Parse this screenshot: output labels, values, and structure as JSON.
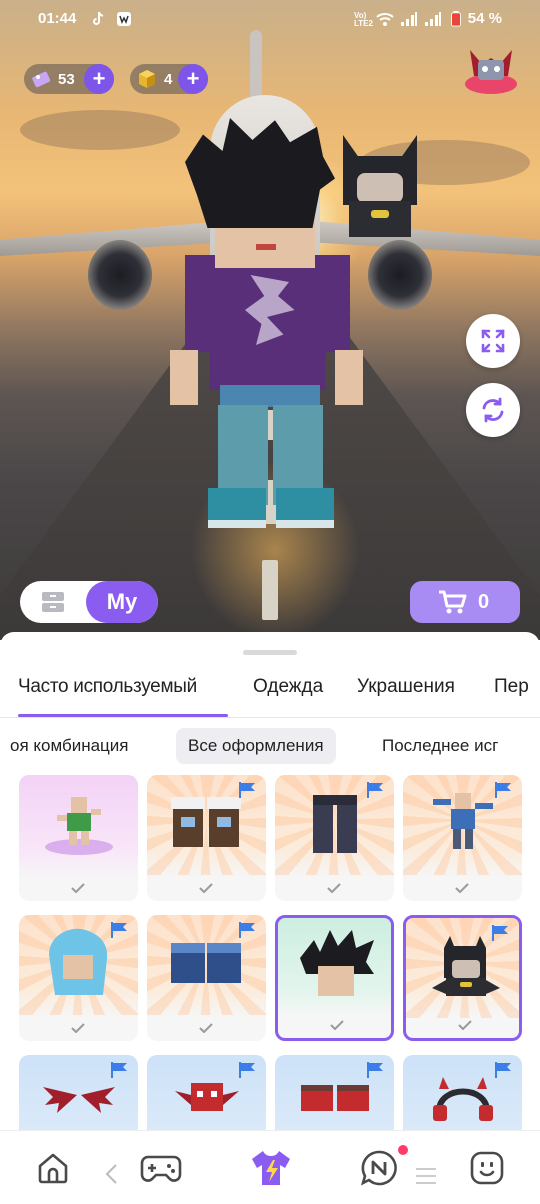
{
  "status_bar": {
    "time": "01:44",
    "network": "Vo) LTE2",
    "battery": "54 %"
  },
  "currency": {
    "gems": "53",
    "cubes": "4"
  },
  "colors": {
    "accent": "#8a5cf0",
    "accent_light": "#a88bf3",
    "plus_button": "#7d55e8",
    "notification_dot": "#ff3b6b"
  },
  "controls": {
    "mode_label": "My",
    "cart_count": "0"
  },
  "tabs": [
    {
      "label": "Часто используемый",
      "active": true
    },
    {
      "label": "Одежда",
      "active": false
    },
    {
      "label": "Украшения",
      "active": false
    },
    {
      "label": "Пер",
      "active": false
    }
  ],
  "filters": [
    {
      "label": "оя комбинация",
      "active": false
    },
    {
      "label": "Все оформления",
      "active": true
    },
    {
      "label": "Последнее исг",
      "active": false
    }
  ],
  "items": [
    {
      "icon": "dance-pose-icon",
      "flag": false,
      "selected": false,
      "bg": "pink"
    },
    {
      "icon": "boots-icon",
      "flag": true,
      "selected": false,
      "bg": "peach"
    },
    {
      "icon": "dark-pants-icon",
      "flag": true,
      "selected": false,
      "bg": "peach"
    },
    {
      "icon": "dab-pose-icon",
      "flag": true,
      "selected": false,
      "bg": "peach"
    },
    {
      "icon": "blue-hair-icon",
      "flag": true,
      "selected": false,
      "bg": "peach"
    },
    {
      "icon": "blue-shoes-icon",
      "flag": true,
      "selected": false,
      "bg": "peach"
    },
    {
      "icon": "spiky-black-hair-icon",
      "flag": false,
      "selected": true,
      "bg": "green"
    },
    {
      "icon": "batman-pet-icon",
      "flag": true,
      "selected": true,
      "bg": "peach"
    },
    {
      "icon": "red-wings-icon",
      "flag": true,
      "selected": false,
      "bg": "blue"
    },
    {
      "icon": "red-demon-pet-icon",
      "flag": true,
      "selected": false,
      "bg": "blue"
    },
    {
      "icon": "red-sneakers-icon",
      "flag": true,
      "selected": false,
      "bg": "blue"
    },
    {
      "icon": "devil-headphones-icon",
      "flag": true,
      "selected": false,
      "bg": "blue"
    }
  ],
  "nav": [
    "home-icon",
    "gamepad-icon",
    "avatar-shirt-icon",
    "news-chat-icon",
    "smiley-icon"
  ]
}
